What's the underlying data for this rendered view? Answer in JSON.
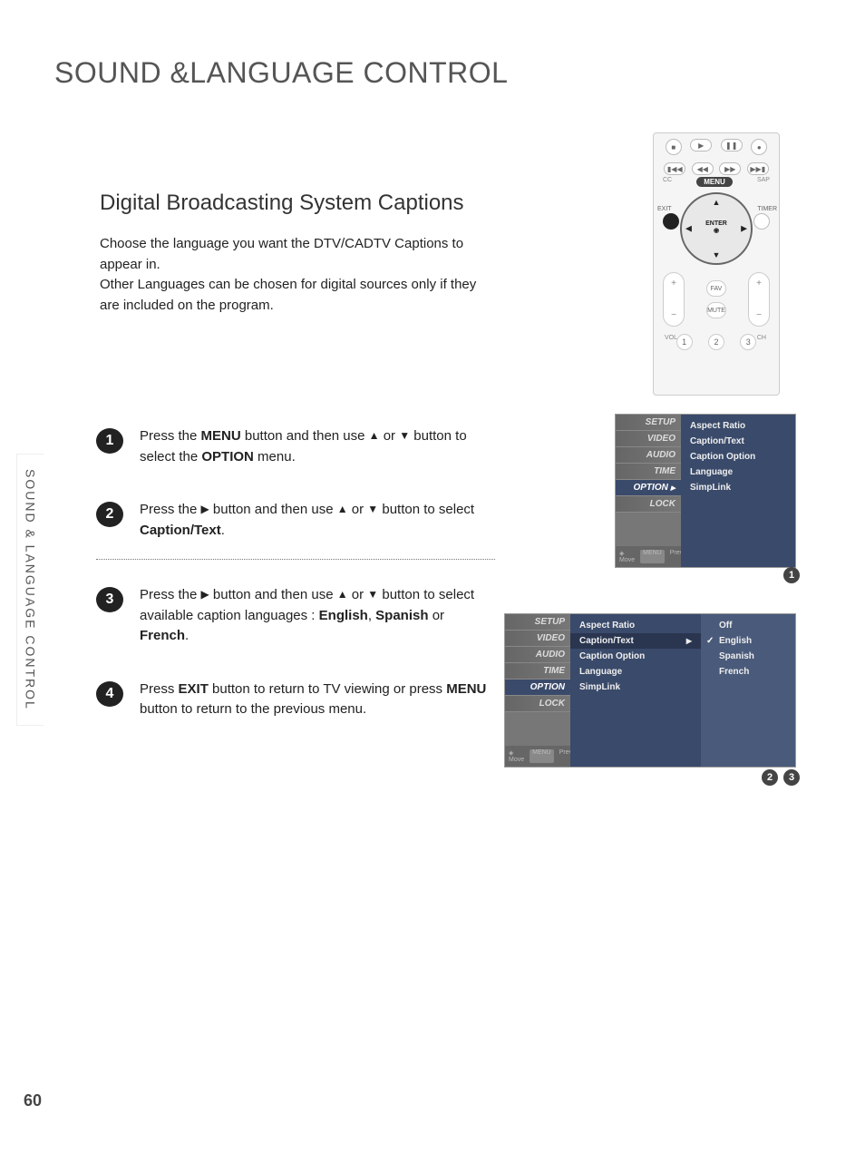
{
  "page": {
    "title": "SOUND &LANGUAGE CONTROL",
    "section_title": "Digital Broadcasting System Captions",
    "intro_l1": "Choose the language you want the DTV/CADTV Captions to appear in.",
    "intro_l2": "Other Languages can be chosen for digital sources only if they are included on the program.",
    "side_tab": "SOUND & LANGUAGE CONTROL",
    "page_number": "60"
  },
  "steps": {
    "s1": {
      "num": "1",
      "pre": "Press the ",
      "b1": "MENU",
      "mid": " button and then use ",
      "mid2": " or ",
      "mid3": " button to select the ",
      "b2": "OPTION",
      "end": " menu."
    },
    "s2": {
      "num": "2",
      "pre": "Press the ",
      "mid": " button and then use ",
      "mid2": " or ",
      "mid3": " button to select ",
      "b1": "Caption/Text",
      "end": "."
    },
    "s3": {
      "num": "3",
      "pre": "Press the ",
      "mid": " button and then use ",
      "mid2": " or ",
      "mid3": " button to select available caption languages : ",
      "b1": "English",
      "comma": ", ",
      "b2": "Spanish",
      "or": " or ",
      "b3": "French",
      "end": "."
    },
    "s4": {
      "num": "4",
      "pre": "Press ",
      "b1": "EXIT",
      "mid": " button to return to TV viewing or press ",
      "b2": "MENU",
      "end": " button to return to the previous menu."
    }
  },
  "remote": {
    "cc": "CC",
    "sap": "SAP",
    "menu": "MENU",
    "exit": "EXIT",
    "timer": "TIMER",
    "enter": "ENTER",
    "vol": "VOL",
    "ch": "CH",
    "fav": "FAV",
    "mute": "MUTE",
    "n1": "1",
    "n2": "2",
    "n3": "3"
  },
  "osd1": {
    "sidebar": [
      "SETUP",
      "VIDEO",
      "AUDIO",
      "TIME",
      "OPTION",
      "LOCK"
    ],
    "sidebar_selected": "OPTION",
    "footer_move": "Move",
    "footer_prev": "Prev",
    "panel": [
      "Aspect Ratio",
      "Caption/Text",
      "Caption Option",
      "Language",
      "SimpLink"
    ]
  },
  "osd2": {
    "sidebar": [
      "SETUP",
      "VIDEO",
      "AUDIO",
      "TIME",
      "OPTION",
      "LOCK"
    ],
    "sidebar_selected": "OPTION",
    "footer_move": "Move",
    "footer_prev": "Prev",
    "panel": [
      "Aspect Ratio",
      "Caption/Text",
      "Caption Option",
      "Language",
      "SimpLink"
    ],
    "panel_selected": "Caption/Text",
    "sub": [
      "Off",
      "English",
      "Spanish",
      "French"
    ],
    "sub_checked": "English"
  },
  "callouts": {
    "c1": "1",
    "c2": "2",
    "c3": "3"
  },
  "glyphs": {
    "up": "▲",
    "down": "▼",
    "left": "◀",
    "right": "▶",
    "ring": "◉",
    "plus": "+",
    "minus": "−",
    "play": "▶",
    "pause": "❚❚",
    "stop": "■",
    "prev": "▮◀◀",
    "next": "▶▶▮",
    "rew": "◀◀",
    "fwd": "▶▶"
  }
}
